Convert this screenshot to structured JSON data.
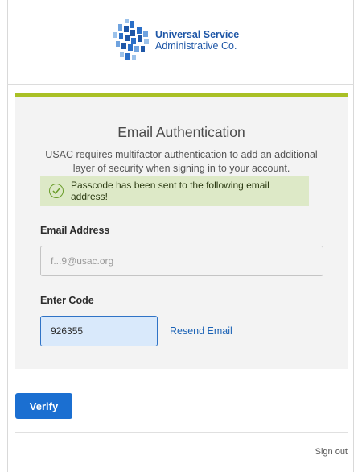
{
  "header": {
    "logo_line1": "Universal Service",
    "logo_line2": "Administrative Co.",
    "colors": {
      "brand_blue": "#1f57a7",
      "accent_green": "#a9c025"
    }
  },
  "auth": {
    "title": "Email Authentication",
    "description": "USAC requires multifactor authentication to add an additional layer of security when signing in to your account.",
    "alert": {
      "icon": "check-circle-icon",
      "message": "Passcode has been sent to the following email address!"
    },
    "email_label": "Email Address",
    "email_value": "f...9@usac.org",
    "code_label": "Enter Code",
    "code_value": "926355",
    "resend_label": "Resend Email"
  },
  "actions": {
    "verify_label": "Verify",
    "signout_label": "Sign out"
  }
}
